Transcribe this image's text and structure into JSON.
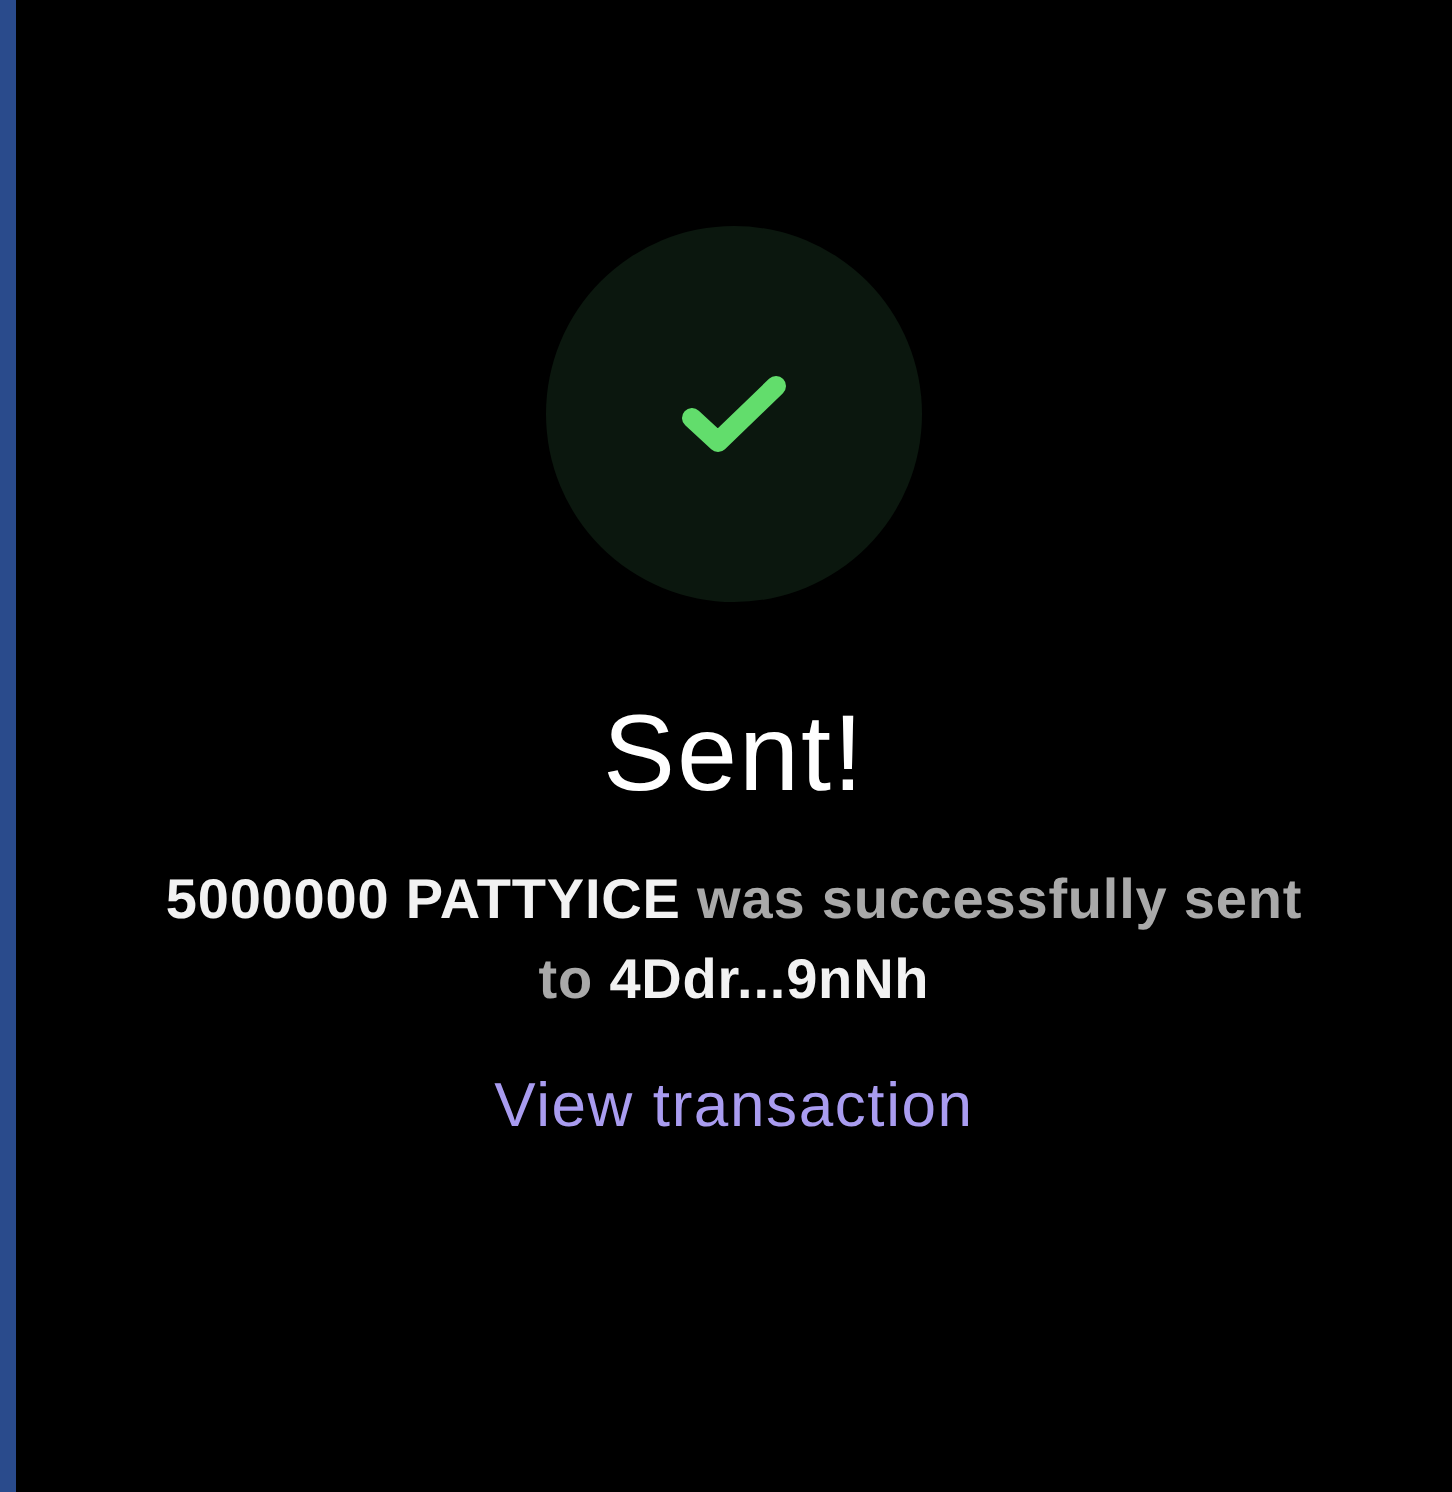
{
  "status": {
    "kind": "success"
  },
  "title": "Sent!",
  "message": "**5000000 PATTYICE** was successfully sent to **4Ddr...9nNh**",
  "link": "View transaction"
}
